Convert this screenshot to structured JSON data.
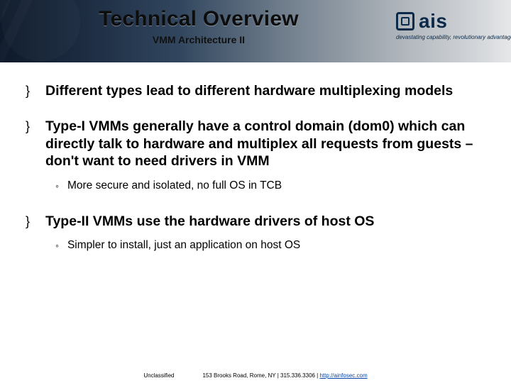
{
  "header": {
    "title": "Technical Overview",
    "subtitle": "VMM Architecture II"
  },
  "logo": {
    "text": "ais",
    "tagline": "devastating capability, revolutionary advantage"
  },
  "bullets": [
    {
      "text": "Different types lead to different hardware multiplexing models",
      "sub": null
    },
    {
      "text": "Type-I VMMs generally have a control domain (dom0) which can directly talk to hardware and multiplex all requests from guests – don't want to need drivers in VMM",
      "sub": "More secure and isolated, no full OS in TCB"
    },
    {
      "text": "Type-II VMMs use the hardware drivers of host OS",
      "sub": "Simpler to install, just an application on host OS"
    }
  ],
  "footer": {
    "classification": "Unclassified",
    "contact_prefix": "153 Brooks Road, Rome, NY | 315.336.3306 | ",
    "url": "http://ainfosec.com"
  }
}
